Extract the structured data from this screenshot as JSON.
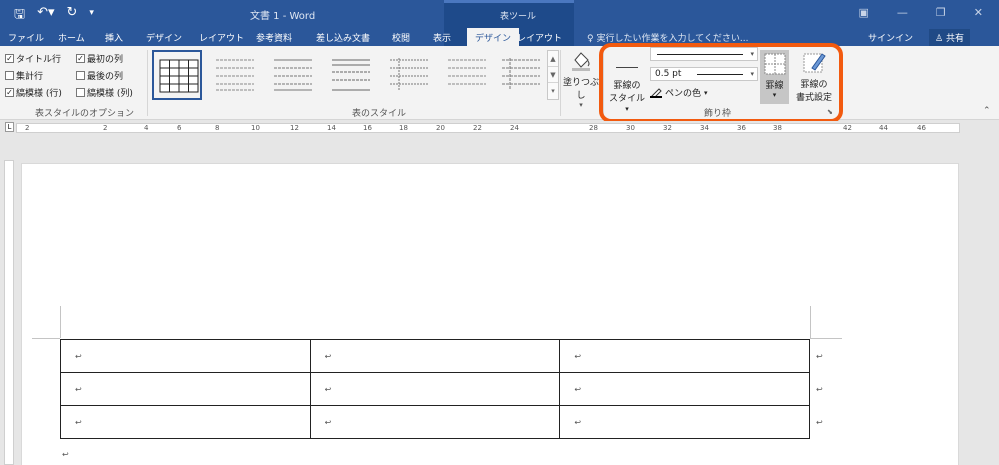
{
  "titlebar": {
    "doc_title": "文書 1 - Word",
    "context_label": "表ツール",
    "qat_save_icon": "save-icon",
    "qat_undo_icon": "undo-icon",
    "qat_redo_icon": "redo-icon",
    "window_buttons": [
      "ribbon-display-options-icon",
      "minimize-icon",
      "restore-icon",
      "close-icon"
    ]
  },
  "tabs": [
    {
      "label": "ファイル"
    },
    {
      "label": "ホーム"
    },
    {
      "label": "挿入"
    },
    {
      "label": "デザイン"
    },
    {
      "label": "レイアウト"
    },
    {
      "label": "参考資料"
    },
    {
      "label": "差し込み文書"
    },
    {
      "label": "校閲"
    },
    {
      "label": "表示"
    },
    {
      "label": "デザイン"
    },
    {
      "label": "レイアウト"
    }
  ],
  "tell_me": "実行したい作業を入力してください...",
  "sign_in": "サインイン",
  "share": "共有",
  "ribbon": {
    "style_options": {
      "header_row": "タイトル行",
      "first_column": "最初の列",
      "total_row": "集計行",
      "last_column": "最後の列",
      "banded_rows": "縞模様 (行)",
      "banded_columns": "縞模様 (列)",
      "group_label": "表スタイルのオプション"
    },
    "table_styles_label": "表のスタイル",
    "shading_label": "塗りつぶし",
    "borders": {
      "border_styles_line1": "罫線の",
      "border_styles_line2": "スタイル",
      "pen_weight": "0.5 pt",
      "pen_color": "ペンの色",
      "borders_label": "罫線",
      "border_painter_line1": "罫線の",
      "border_painter_line2": "書式設定",
      "group_label": "飾り枠"
    }
  },
  "ruler_numbers": [
    "2",
    "2",
    "4",
    "6",
    "8",
    "10",
    "12",
    "14",
    "16",
    "18",
    "20",
    "22",
    "24",
    "28",
    "30",
    "32",
    "34",
    "36",
    "38",
    "42",
    "44",
    "46"
  ],
  "document": {
    "cell_mark": "↩",
    "row_mark": "↩",
    "para_mark": "↩"
  }
}
